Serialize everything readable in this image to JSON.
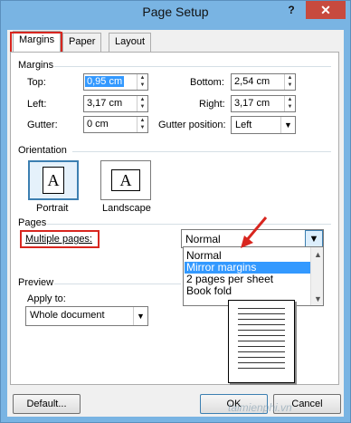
{
  "window": {
    "title": "Page Setup",
    "help": "?",
    "close": "✕"
  },
  "tabs": [
    {
      "label": "Margins",
      "active": true
    },
    {
      "label": "Paper",
      "active": false
    },
    {
      "label": "Layout",
      "active": false
    }
  ],
  "margins": {
    "section_label": "Margins",
    "top": {
      "label": "Top:",
      "value": "0,95 cm"
    },
    "bottom": {
      "label": "Bottom:",
      "value": "2,54 cm"
    },
    "left": {
      "label": "Left:",
      "value": "3,17 cm"
    },
    "right": {
      "label": "Right:",
      "value": "3,17 cm"
    },
    "gutter": {
      "label": "Gutter:",
      "value": "0 cm"
    },
    "gutter_position": {
      "label": "Gutter position:",
      "value": "Left"
    }
  },
  "orientation": {
    "section_label": "Orientation",
    "portrait": {
      "label": "Portrait",
      "glyph": "A",
      "selected": true
    },
    "landscape": {
      "label": "Landscape",
      "glyph": "A",
      "selected": false
    }
  },
  "pages": {
    "section_label": "Pages",
    "multiple_pages_label": "Multiple pages:",
    "multiple_pages_value": "Normal",
    "options": [
      "Normal",
      "Mirror margins",
      "2 pages per sheet",
      "Book fold"
    ],
    "highlighted_option": "Mirror margins"
  },
  "preview": {
    "section_label": "Preview",
    "apply_to_label": "Apply to:",
    "apply_to_value": "Whole document"
  },
  "buttons": {
    "default": "Default...",
    "ok": "OK",
    "cancel": "Cancel"
  },
  "watermark": "taimienphi.vn",
  "colors": {
    "highlight_red": "#d8261f",
    "selection_blue": "#3399ff",
    "titlebar": "#79b4e3",
    "close": "#c74a3e"
  }
}
